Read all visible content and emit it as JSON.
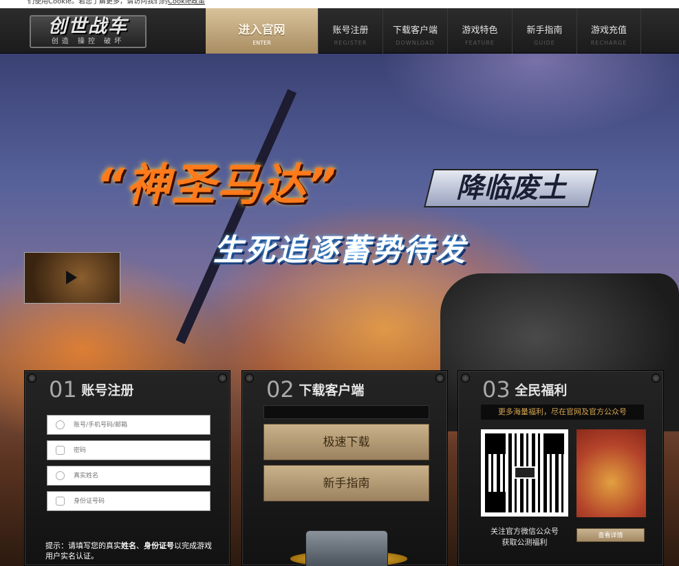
{
  "cookie_notice": {
    "text": "们使用Cookie。若您了解更多，请访问我们的",
    "link": "Cookie政策"
  },
  "nav": {
    "logo": {
      "main": "创世战车",
      "sub": "创造 操控 破坏"
    },
    "enter": {
      "label": "进入官网",
      "sub": "ENTER"
    },
    "items": [
      {
        "label": "账号注册",
        "sub": "REGISTER"
      },
      {
        "label": "下载客户端",
        "sub": "DOWNLOAD"
      },
      {
        "label": "游戏特色",
        "sub": "FEATURE"
      },
      {
        "label": "新手指南",
        "sub": "GUIDE"
      },
      {
        "label": "游戏充值",
        "sub": "RECHARGE"
      }
    ]
  },
  "hero": {
    "headline": "“神圣马达”",
    "badge": "降临废土",
    "subline": "生死追逐蓄势待发"
  },
  "register_panel": {
    "num": "01",
    "title": "账号注册",
    "fields": [
      {
        "placeholder": "账号/手机号码/邮箱",
        "icon": "user-icon"
      },
      {
        "placeholder": "密码",
        "icon": "lock-icon"
      },
      {
        "placeholder": "真实姓名",
        "icon": "user-icon"
      },
      {
        "placeholder": "身份证号码",
        "icon": "id-card-icon"
      }
    ],
    "hint_prefix": "提示：请填写您的真实",
    "hint_name": "姓名",
    "hint_sep": "、",
    "hint_id": "身份证号",
    "hint_suffix": "以完成游戏用户实名认证。"
  },
  "download_panel": {
    "num": "02",
    "title": "下载客户端",
    "fast_download": "极速下载",
    "guide": "新手指南"
  },
  "welfare_panel": {
    "num": "03",
    "title": "全民福利",
    "banner": "更多海量福利，尽在官网及官方公众号",
    "qr_caption_1": "关注官方微信公众号",
    "qr_caption_2": "获取公测福利",
    "detail_button": "查看详情"
  }
}
